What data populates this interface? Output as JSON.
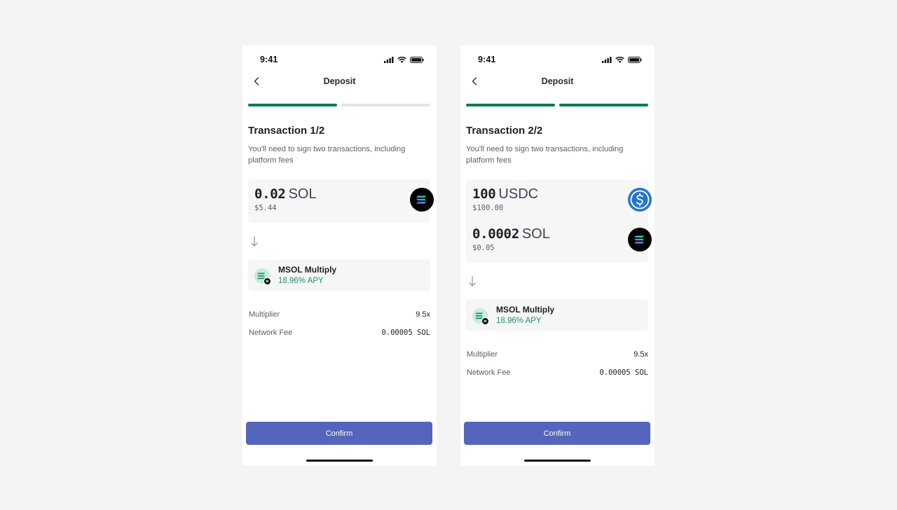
{
  "colors": {
    "accent": "#5465bb",
    "progress_active": "#0b7a5d",
    "progress_inactive": "#e3e4e6",
    "apy_green": "#1c9265",
    "usdc_blue": "#2775ca",
    "sol_black": "#000000"
  },
  "screens": [
    {
      "status": {
        "time": "9:41",
        "icons": [
          "signal-icon",
          "wifi-icon",
          "battery-icon"
        ]
      },
      "nav": {
        "title": "Deposit",
        "back_icon": "chevron-left-icon"
      },
      "progress": {
        "current_step": 1,
        "total_steps": 2
      },
      "heading": "Transaction 1/2",
      "subtext": "You'll need to sign two transactions, including platform fees",
      "tokens": [
        {
          "amount": "0.02",
          "symbol": "SOL",
          "usd": "$5.44",
          "icon": "solana-logo-icon"
        }
      ],
      "vault": {
        "name": "MSOL Multiply",
        "apy": "18.96% APY",
        "icon": "msol-vault-icon"
      },
      "details": [
        {
          "label": "Multiplier",
          "value": "9.5x"
        },
        {
          "label": "Network Fee",
          "value": "0.00005 SOL"
        }
      ],
      "confirm_label": "Confirm"
    },
    {
      "status": {
        "time": "9:41",
        "icons": [
          "signal-icon",
          "wifi-icon",
          "battery-icon"
        ]
      },
      "nav": {
        "title": "Deposit",
        "back_icon": "chevron-left-icon"
      },
      "progress": {
        "current_step": 2,
        "total_steps": 2
      },
      "heading": "Transaction 2/2",
      "subtext": "You'll need to sign two transactions, including platform fees",
      "tokens": [
        {
          "amount": "100",
          "symbol": "USDC",
          "usd": "$100.00",
          "icon": "usdc-logo-icon"
        },
        {
          "amount": "0.0002",
          "symbol": "SOL",
          "usd": "$0.05",
          "icon": "solana-logo-icon"
        }
      ],
      "vault": {
        "name": "MSOL Multiply",
        "apy": "18.96% APY",
        "icon": "msol-vault-icon"
      },
      "details": [
        {
          "label": "Multiplier",
          "value": "9.5x"
        },
        {
          "label": "Network Fee",
          "value": "0.00005 SOL"
        }
      ],
      "confirm_label": "Confirm"
    }
  ]
}
